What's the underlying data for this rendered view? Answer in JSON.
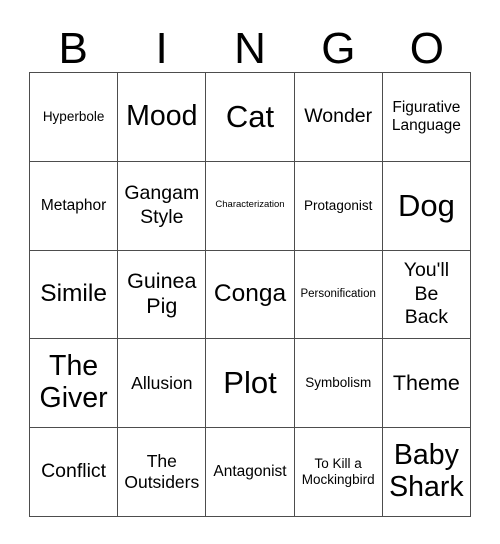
{
  "card": {
    "title": "BINGO",
    "header_letters": [
      "B",
      "I",
      "N",
      "G",
      "O"
    ],
    "colors": {
      "background": "#ffffff",
      "text": "#000000",
      "grid_line": "#4d4d4d"
    },
    "grid": {
      "columns": 5,
      "rows": 5,
      "cells": [
        {
          "text": "Hyperbole",
          "size": "fs-13"
        },
        {
          "text": "Mood",
          "size": "fs-28"
        },
        {
          "text": "Cat",
          "size": "fs-31"
        },
        {
          "text": "Wonder",
          "size": "fs-19"
        },
        {
          "text": "Figurative\nLanguage",
          "size": "fs-15"
        },
        {
          "text": "Metaphor",
          "size": "fs-15"
        },
        {
          "text": "Gangam\nStyle",
          "size": "fs-19"
        },
        {
          "text": "Characterization",
          "size": "fs-9"
        },
        {
          "text": "Protagonist",
          "size": "fs-13"
        },
        {
          "text": "Dog",
          "size": "fs-31"
        },
        {
          "text": "Simile",
          "size": "fs-24"
        },
        {
          "text": "Guinea\nPig",
          "size": "fs-21"
        },
        {
          "text": "Conga",
          "size": "fs-24"
        },
        {
          "text": "Personification",
          "size": "fs-11"
        },
        {
          "text": "You'll\nBe\nBack",
          "size": "fs-19"
        },
        {
          "text": "The\nGiver",
          "size": "fs-28"
        },
        {
          "text": "Allusion",
          "size": "fs-17"
        },
        {
          "text": "Plot",
          "size": "fs-31"
        },
        {
          "text": "Symbolism",
          "size": "fs-13"
        },
        {
          "text": "Theme",
          "size": "fs-21"
        },
        {
          "text": "Conflict",
          "size": "fs-19"
        },
        {
          "text": "The\nOutsiders",
          "size": "fs-17"
        },
        {
          "text": "Antagonist",
          "size": "fs-15"
        },
        {
          "text": "To Kill a\nMockingbird",
          "size": "fs-13"
        },
        {
          "text": "Baby\nShark",
          "size": "fs-28"
        }
      ]
    }
  }
}
